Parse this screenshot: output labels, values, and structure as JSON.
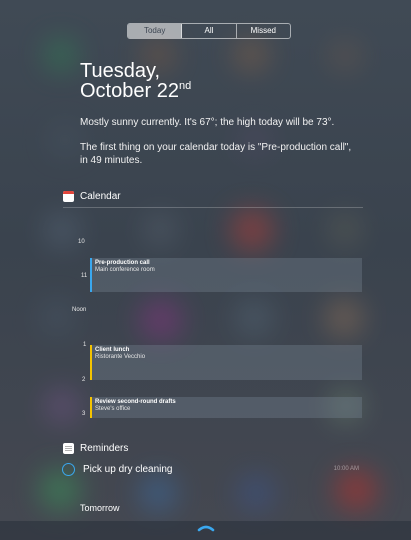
{
  "segments": {
    "today": "Today",
    "all": "All",
    "missed": "Missed",
    "selected": "Today"
  },
  "date": {
    "weekday": "Tuesday,",
    "month_day": "October 22",
    "ordinal": "nd"
  },
  "summary": {
    "weather": "Mostly sunny currently. It's 67°; the high today will be 73°.",
    "calendar_note": "The first thing on your calendar today is \"Pre-production call\", in 49 minutes."
  },
  "calendar": {
    "heading": "Calendar",
    "hours": [
      "10",
      "11",
      "Noon",
      "1",
      "2",
      "3"
    ],
    "events": [
      {
        "title": "Pre-production call",
        "location": "Main conference room",
        "color": "#3aa8ef"
      },
      {
        "title": "Client lunch",
        "location": "Ristorante Vecchio",
        "color": "#f5c400"
      },
      {
        "title": "Review second-round drafts",
        "location": "Steve's office",
        "color": "#f5c400"
      }
    ]
  },
  "reminders": {
    "heading": "Reminders",
    "items": [
      {
        "text": "Pick up dry cleaning",
        "time": "10:00 AM"
      }
    ]
  },
  "tomorrow": {
    "heading": "Tomorrow"
  },
  "colors": {
    "accent_blue": "#3aa8ef",
    "accent_yellow": "#f5c400",
    "calendar_red": "#e2463c"
  },
  "icons": {
    "calendar": "calendar-icon",
    "reminders": "reminders-icon",
    "reminder_check": "circle-check-icon",
    "pull_handle": "chevron-up-handle-icon"
  }
}
